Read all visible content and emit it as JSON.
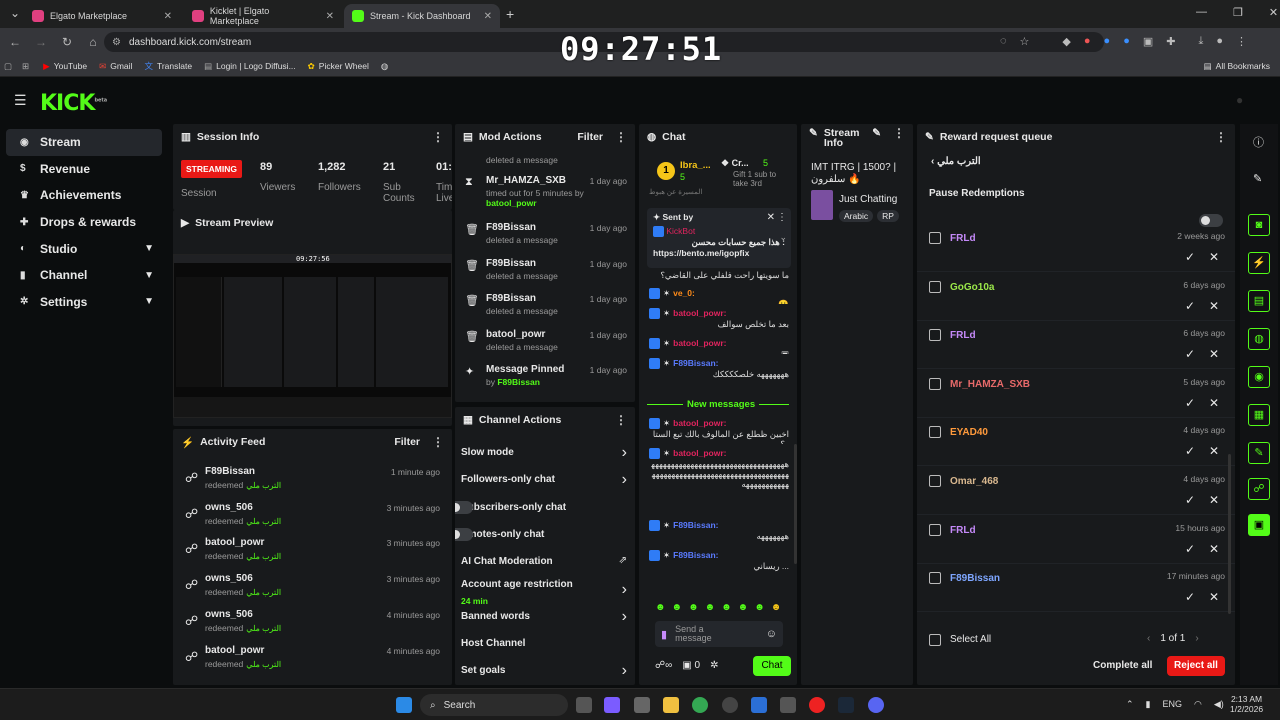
{
  "browser": {
    "tabs": [
      {
        "title": "Elgato Marketplace"
      },
      {
        "title": "Kicklet | Elgato Marketplace"
      },
      {
        "title": "Stream - Kick Dashboard"
      }
    ],
    "url": "dashboard.kick.com/stream",
    "bookmarks": [
      "YouTube",
      "Gmail",
      "Translate",
      "Login | Logo Diffusi...",
      "Picker Wheel"
    ],
    "all_bookmarks": "All Bookmarks"
  },
  "clock": "09:27:51",
  "logo": "KICK",
  "logo_sup": "beta",
  "sidebar": {
    "items": [
      {
        "label": "Stream",
        "icon": "stream-icon"
      },
      {
        "label": "Revenue",
        "icon": "dollar-icon"
      },
      {
        "label": "Achievements",
        "icon": "trophy-icon"
      },
      {
        "label": "Drops & rewards",
        "icon": "gift-icon"
      },
      {
        "label": "Studio",
        "icon": "studio-icon"
      },
      {
        "label": "Channel",
        "icon": "channel-icon"
      },
      {
        "label": "Settings",
        "icon": "gear-icon"
      }
    ]
  },
  "session": {
    "title": "Session Info",
    "streaming": "STREAMING",
    "session_label": "Session",
    "stats": [
      {
        "value": "89",
        "label": "Viewers"
      },
      {
        "value": "1,282",
        "label": "Followers"
      },
      {
        "value": "21",
        "label": "Sub Counts"
      },
      {
        "value": "01:",
        "label": "Tim Live"
      }
    ]
  },
  "preview": {
    "title": "Stream Preview",
    "clock": "09:27:56"
  },
  "activity": {
    "title": "Activity Feed",
    "filter": "Filter",
    "items": [
      {
        "user": "F89Bissan",
        "time": "1 minute ago",
        "action": "redeemed",
        "reward": "الترب ملي"
      },
      {
        "user": "owns_506",
        "time": "3 minutes ago",
        "action": "redeemed",
        "reward": "الترب ملي"
      },
      {
        "user": "batool_powr",
        "time": "3 minutes ago",
        "action": "redeemed",
        "reward": "الترب ملي"
      },
      {
        "user": "owns_506",
        "time": "3 minutes ago",
        "action": "redeemed",
        "reward": "الترب ملي"
      },
      {
        "user": "owns_506",
        "time": "4 minutes ago",
        "action": "redeemed",
        "reward": "الترب ملي"
      },
      {
        "user": "batool_powr",
        "time": "4 minutes ago",
        "action": "redeemed",
        "reward": "الترب ملي"
      }
    ]
  },
  "mod": {
    "title": "Mod Actions",
    "filter": "Filter",
    "top_sub": "deleted a message",
    "items": [
      {
        "user": "Mr_HAMZA_SXB",
        "time": "1 day ago",
        "sub": "timed out for 5 minutes by",
        "by": "batool_powr",
        "icon": "hourglass-icon"
      },
      {
        "user": "F89Bissan",
        "time": "1 day ago",
        "sub": "deleted a message",
        "icon": "trash-icon"
      },
      {
        "user": "F89Bissan",
        "time": "1 day ago",
        "sub": "deleted a message",
        "icon": "trash-icon"
      },
      {
        "user": "F89Bissan",
        "time": "1 day ago",
        "sub": "deleted a message",
        "icon": "trash-icon"
      },
      {
        "user": "batool_powr",
        "time": "1 day ago",
        "sub": "deleted a message",
        "icon": "trash-icon"
      },
      {
        "user": "Message Pinned",
        "time": "1 day ago",
        "sub": "by",
        "by": "F89Bissan",
        "icon": "pin-icon"
      }
    ]
  },
  "channel_actions": {
    "title": "Channel Actions",
    "items": [
      {
        "label": "Slow mode",
        "ctrl": "chevron"
      },
      {
        "label": "Followers-only chat",
        "ctrl": "chevron"
      },
      {
        "label": "Subscribers-only chat",
        "ctrl": "toggle"
      },
      {
        "label": "Emotes-only chat",
        "ctrl": "toggle"
      },
      {
        "label": "AI Chat Moderation",
        "ctrl": "external"
      },
      {
        "label": "Account age restriction",
        "sub": "24 min",
        "ctrl": "chevron"
      },
      {
        "label": "Banned words",
        "ctrl": "chevron"
      },
      {
        "label": "Host Channel",
        "ctrl": "none"
      },
      {
        "label": "Set goals",
        "ctrl": "chevron"
      }
    ]
  },
  "chat": {
    "title": "Chat",
    "top1_name": "Ibra_...",
    "top1_count": "5",
    "top2_name": "Cr...",
    "top2_count": "5",
    "top2_sub": "Gift 1 sub to take 3rd",
    "pinned_label": "Sent by",
    "pinned_user": "KickBot",
    "pinned_text": "هذا جميع حسابات محسن :",
    "pinned_link": "https://bento.me/igopfix",
    "banner": "المسيرة عن هبوط",
    "messages": [
      {
        "user": "",
        "text": "ما سويتها راحت فلفلي على القاضي؟",
        "color": "#ccc"
      },
      {
        "user": "ve_0:",
        "text": "🙂",
        "color": "#ff8c1a"
      },
      {
        "user": "batool_powr:",
        "text": "بعد ما تخلص سوالف",
        "color": "#e0245e"
      },
      {
        "user": "batool_powr:",
        "text": "▣",
        "color": "#e0245e"
      },
      {
        "user": "F89Bissan:",
        "text": "هههههههه خلصككككك",
        "color": "#5a7bff"
      }
    ],
    "new_messages": "New messages",
    "messages2": [
      {
        "user": "batool_powr:",
        "text": "اخبين ظطلع عن المالوف بالك تبع الستار؟",
        "color": "#e0245e"
      },
      {
        "user": "batool_powr:",
        "text": "هههههههههههههههههههههههههههههههههههههههههههههههههههههههههههههههههههههههههههههههههه",
        "color": "#e0245e"
      },
      {
        "user": "F89Bissan:",
        "text": "هههههههه",
        "color": "#5a7bff"
      },
      {
        "user": "F89Bissan:",
        "text": "ريساني ...",
        "color": "#5a7bff"
      }
    ],
    "input_placeholder": "Send a message",
    "send": "Chat",
    "viewer_count": "0"
  },
  "stream_info": {
    "title": "Stream Info",
    "stream_title": "IMT ITRG | 1500? | سلفرون 🔥",
    "category": "Just Chatting",
    "tags": [
      "Arabic",
      "RP"
    ]
  },
  "queue": {
    "title": "Reward request queue",
    "reward": "الترب ملي",
    "pause": "Pause Redemptions",
    "items": [
      {
        "user": "FRLd",
        "time": "2 weeks ago",
        "color": "#c58af9"
      },
      {
        "user": "GoGo10a",
        "time": "6 days ago",
        "color": "#9be84a"
      },
      {
        "user": "FRLd",
        "time": "6 days ago",
        "color": "#c58af9"
      },
      {
        "user": "Mr_HAMZA_SXB",
        "time": "5 days ago",
        "color": "#e86a6a"
      },
      {
        "user": "EYAD40",
        "time": "4 days ago",
        "color": "#ff9a3c"
      },
      {
        "user": "Omar_468",
        "time": "4 days ago",
        "color": "#d9b88f"
      },
      {
        "user": "FRLd",
        "time": "15 hours ago",
        "color": "#c58af9"
      },
      {
        "user": "F89Bissan",
        "time": "17 minutes ago",
        "color": "#7ea6ff"
      }
    ],
    "select_all": "Select All",
    "pagination": "1 of 1",
    "complete_all": "Complete all",
    "reject_all": "Reject all"
  },
  "taskbar": {
    "search": "Search",
    "lang": "ENG",
    "time": "2:13 AM",
    "date": "1/2/2026"
  },
  "colors": {
    "accent": "#53fc18",
    "danger": "#e91916",
    "panel": "#181a1c"
  }
}
